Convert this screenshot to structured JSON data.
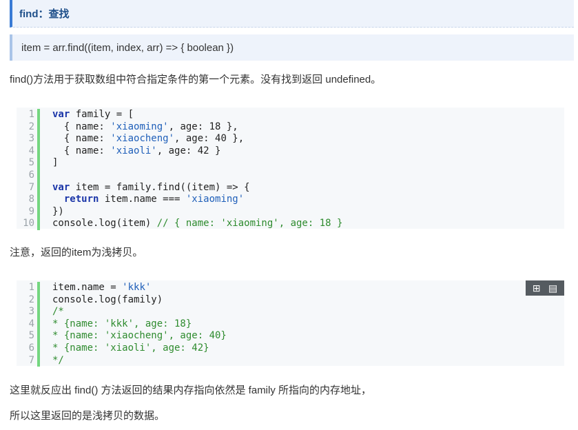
{
  "heading": "find：查找",
  "signature": "item = arr.find((item, index, arr) => { boolean })",
  "paragraphs": {
    "p1": "find()方法用于获取数组中符合指定条件的第一个元素。没有找到返回 undefined。",
    "p2": "注意，返回的item为浅拷贝。",
    "p3": "这里就反应出 find() 方法返回的结果内存指向依然是 family 所指向的内存地址，",
    "p4": "所以这里返回的是浅拷贝的数据。"
  },
  "code1": {
    "line_numbers": [
      "1",
      "2",
      "3",
      "4",
      "5",
      "6",
      "7",
      "8",
      "9",
      "10"
    ],
    "lines": [
      [
        {
          "t": "kw",
          "v": "var"
        },
        {
          "t": "code",
          "v": " family = ["
        }
      ],
      [
        {
          "t": "code",
          "v": "  { name: "
        },
        {
          "t": "str",
          "v": "'xiaoming'"
        },
        {
          "t": "code",
          "v": ", age: 18 },"
        }
      ],
      [
        {
          "t": "code",
          "v": "  { name: "
        },
        {
          "t": "str",
          "v": "'xiaocheng'"
        },
        {
          "t": "code",
          "v": ", age: 40 },"
        }
      ],
      [
        {
          "t": "code",
          "v": "  { name: "
        },
        {
          "t": "str",
          "v": "'xiaoli'"
        },
        {
          "t": "code",
          "v": ", age: 42 }"
        }
      ],
      [
        {
          "t": "code",
          "v": "]"
        }
      ],
      [
        {
          "t": "code",
          "v": ""
        }
      ],
      [
        {
          "t": "kw",
          "v": "var"
        },
        {
          "t": "code",
          "v": " item = family.find((item) => {"
        }
      ],
      [
        {
          "t": "code",
          "v": "  "
        },
        {
          "t": "kw",
          "v": "return"
        },
        {
          "t": "code",
          "v": " item.name === "
        },
        {
          "t": "str",
          "v": "'xiaoming'"
        }
      ],
      [
        {
          "t": "code",
          "v": "})"
        }
      ],
      [
        {
          "t": "code",
          "v": "console.log(item) "
        },
        {
          "t": "cm",
          "v": "// { name: 'xiaoming', age: 18 }"
        }
      ]
    ]
  },
  "code2": {
    "line_numbers": [
      "1",
      "2",
      "3",
      "4",
      "5",
      "6",
      "7"
    ],
    "lines": [
      [
        {
          "t": "code",
          "v": "item.name = "
        },
        {
          "t": "str",
          "v": "'kkk'"
        }
      ],
      [
        {
          "t": "code",
          "v": "console.log(family)"
        }
      ],
      [
        {
          "t": "cm",
          "v": "/*"
        }
      ],
      [
        {
          "t": "cm",
          "v": "* {name: 'kkk', age: 18}"
        }
      ],
      [
        {
          "t": "cm",
          "v": "* {name: 'xiaocheng', age: 40}"
        }
      ],
      [
        {
          "t": "cm",
          "v": "* {name: 'xiaoli', age: 42}"
        }
      ],
      [
        {
          "t": "cm",
          "v": "*/"
        }
      ]
    ]
  },
  "toolbar": {
    "view_icon": "view-source-icon",
    "copy_icon": "copy-icon",
    "view_glyph": "⊞",
    "copy_glyph": "▤"
  }
}
